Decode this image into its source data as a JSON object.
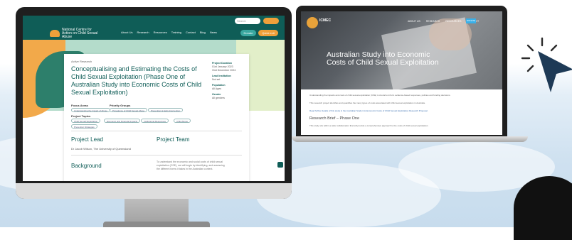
{
  "desktop_site": {
    "search_placeholder": "Search",
    "logo_text": "National Centre for Action on Child Sexual Abuse",
    "nav_links": [
      "About Us",
      "Research",
      "Resources",
      "Training",
      "Contact",
      "Blog",
      "News"
    ],
    "pill_a": "Donate",
    "pill_b": "Quick exit",
    "breadcrumb": "Active Research",
    "title": "Conceptualising and Estimating the Costs of Child Sexual Exploitation (Phase One of Australian Study into Economic Costs of Child Sexual Exploitation)",
    "focus_area_label": "Focus Areas",
    "priority_label": "Priority Groups",
    "tags_row1": [
      "Understanding the Impact of Abuse",
      "Prevalence of Child Sexual Abuse",
      "Prevention & Early Intervention"
    ],
    "topics_label": "Project Topics",
    "tags_row2": [
      "Child Sexual Exploitation",
      "Economic and Financial Impacts",
      "Institutional Responses",
      "Child Abuse",
      "Prevention Strategies"
    ],
    "side": {
      "duration_h": "Project Duration",
      "duration_v1": "01st January 2023",
      "duration_v2": "31st December 2024",
      "lead_h": "Lead Institution",
      "lead_v": "Not set",
      "pop_h": "Population",
      "pop_v": "All Ages",
      "gender_h": "Gender",
      "gender_v": "All genders"
    },
    "lead_heading": "Project Lead",
    "team_heading": "Project Team",
    "lead_name": "Dr Jacob Wilson, The University of Queensland",
    "background_heading": "Background",
    "background_text": "To understand the economic and social costs of child sexual exploitation (CSE), we will begin by identifying, and assessing the different forms it takes in the Australian context."
  },
  "laptop_site": {
    "brand": "ICMEC",
    "nav_links": [
      "ABOUT US",
      "RESEARCH",
      "RESOURCES",
      "CONTACT"
    ],
    "nav_button": "DONATE",
    "hero_title": "Australian Study into Economic Costs of Child Sexual Exploitation",
    "intro_1": "Understanding the impacts and costs of child sexual exploitation (CSE) is crucial to inform evidence-based responses, policies and funding decisions.",
    "intro_2": "This research project identifies and quantifies the many types of costs associated with child sexual exploitation in Australia.",
    "link_text": "Read further details of this study in the Australian Study into Economic Costs of Child Sexual Exploitation Research Proposal.",
    "brief_heading": "Research Brief – Phase One",
    "brief_text": "This study sits within a wider collaboration that will provide a comprehensive approach to the costs of child sexual exploitation."
  },
  "colors": {
    "brand_teal": "#0f5d57",
    "accent_orange": "#f0a03a",
    "cursor_navy": "#1e3a56"
  },
  "icons": [
    "cursor-arrow-icon",
    "click-burst-icon"
  ]
}
